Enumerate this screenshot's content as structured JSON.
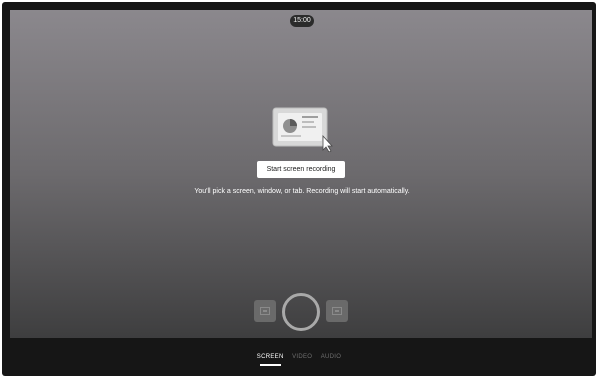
{
  "recording": {
    "timer": "15:00",
    "start_button_label": "Start screen recording",
    "hint_text": "You'll pick a screen, window, or tab. Recording will start automatically.",
    "illustration_icon": "screen-share-illustration"
  },
  "controls": {
    "left_icon": "screen-icon",
    "record_icon": "record-button",
    "right_icon": "video-icon"
  },
  "tabs": [
    {
      "label": "SCREEN",
      "active": true
    },
    {
      "label": "VIDEO",
      "active": false
    },
    {
      "label": "AUDIO",
      "active": false
    }
  ],
  "colors": {
    "stage_top": "#8b888d",
    "stage_bottom": "#3e3e3f",
    "frame": "#161616",
    "button_bg": "#ffffff"
  }
}
